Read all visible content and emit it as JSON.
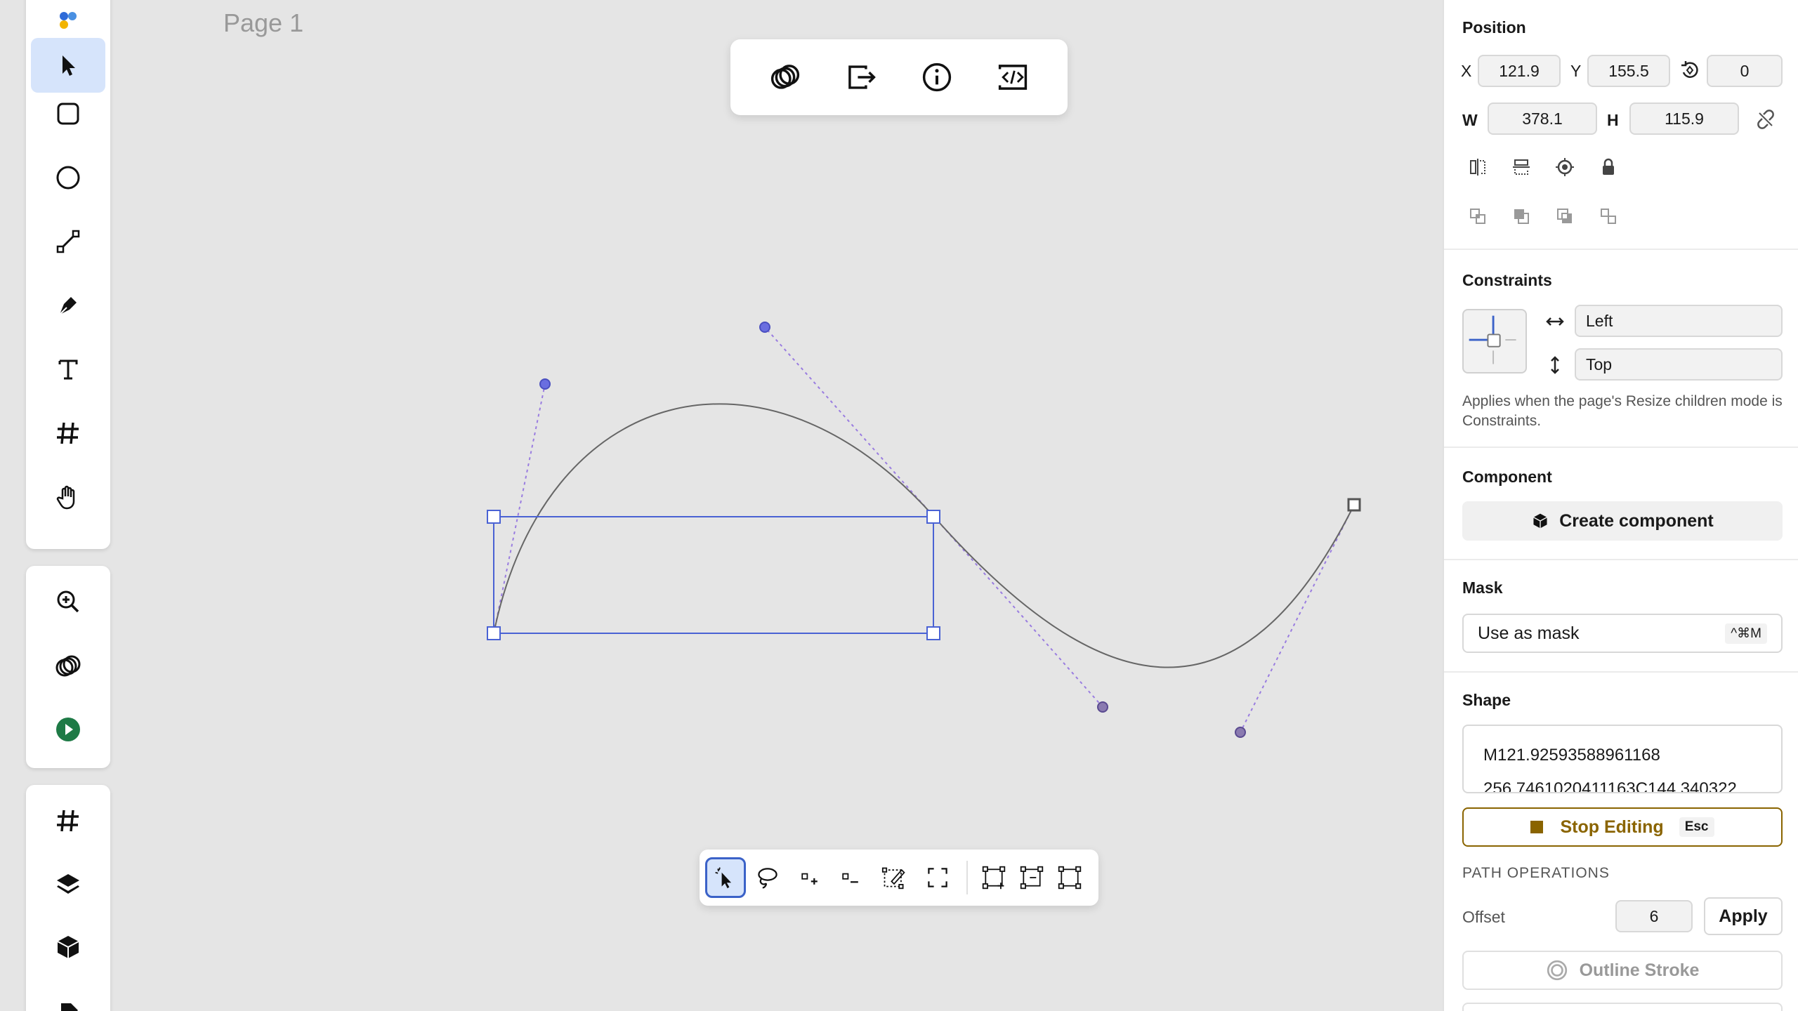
{
  "app": {
    "page_title": "Page 1"
  },
  "left_toolbar": {
    "tools": [
      "move",
      "rectangle",
      "ellipse",
      "line",
      "pen",
      "text",
      "frame",
      "hand"
    ],
    "active_tool": "move",
    "tools2": [
      "zoom",
      "boolean",
      "play"
    ],
    "tools3": [
      "frame",
      "layers",
      "component",
      "more"
    ]
  },
  "top_toolbar": {
    "buttons": [
      "boolean-operations",
      "export",
      "info",
      "embed-code"
    ]
  },
  "path_toolbar": {
    "buttons": [
      "select-points",
      "lasso",
      "add-point",
      "remove-point",
      "edit-path",
      "close-path",
      "insert-node",
      "delete-node",
      "align-nodes"
    ],
    "active": "select-points"
  },
  "panel": {
    "position": {
      "title": "Position",
      "x_label": "X",
      "x": "121.9",
      "y_label": "Y",
      "y": "155.5",
      "rotation": "0",
      "w_label": "W",
      "w": "378.1",
      "h_label": "H",
      "h": "115.9"
    },
    "constraints": {
      "title": "Constraints",
      "horizontal": "Left",
      "vertical": "Top",
      "note": "Applies when the page's Resize children mode is Constraints."
    },
    "component": {
      "title": "Component",
      "create_label": "Create component"
    },
    "mask": {
      "title": "Mask",
      "use_label": "Use as mask",
      "shortcut": "^⌘M"
    },
    "shape": {
      "title": "Shape",
      "path_line1": "M121.92593588961168",
      "path_line2": "256.7461020411163C144.340322",
      "stop_label": "Stop Editing",
      "stop_shortcut": "Esc",
      "path_ops_title": "PATH OPERATIONS",
      "offset_label": "Offset",
      "offset_value": "6",
      "apply_label": "Apply",
      "outline_label": "Outline Stroke"
    }
  },
  "colors": {
    "accent": "#4a62d4",
    "handle": "#7b7fe0",
    "stop_border": "#8a6400",
    "play_green": "#1e7a46"
  }
}
